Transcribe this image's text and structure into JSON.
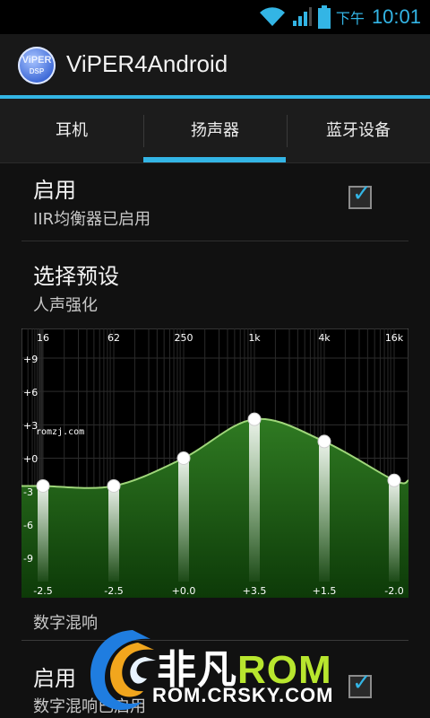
{
  "status_bar": {
    "ampm": "下午",
    "time": "10:01"
  },
  "app": {
    "icon_line1": "ViPER",
    "icon_line2": "DSP",
    "title": "ViPER4Android"
  },
  "tabs": [
    {
      "label": "耳机",
      "selected": false
    },
    {
      "label": "扬声器",
      "selected": true
    },
    {
      "label": "蓝牙设备",
      "selected": false
    }
  ],
  "prefs": {
    "enable": {
      "title": "启用",
      "summary": "IIR均衡器已启用",
      "checked": true
    },
    "preset": {
      "title": "选择预设",
      "summary": "人声强化"
    },
    "section_reverb": "数字混响",
    "enable2": {
      "title": "启用",
      "summary": "数字混响已启用",
      "checked": true
    }
  },
  "equalizer": {
    "freq_labels": [
      "16",
      "62",
      "250",
      "1k",
      "4k",
      "16k"
    ],
    "db_labels": [
      "+9",
      "+6",
      "+3",
      "+0",
      "-3",
      "-6",
      "-9"
    ],
    "bands": [
      {
        "value": -2.5,
        "label": "-2.5"
      },
      {
        "value": -2.5,
        "label": "-2.5"
      },
      {
        "value": 0.0,
        "label": "+0.0"
      },
      {
        "value": 3.5,
        "label": "+3.5"
      },
      {
        "value": 1.5,
        "label": "+1.5"
      },
      {
        "value": -2.0,
        "label": "-2.0"
      }
    ],
    "overlay_text": "romzj.com"
  },
  "watermark": {
    "brand_cn": "非凡",
    "brand_rom": "ROM",
    "url": "ROM.CRSKY.COM"
  },
  "colors": {
    "accent": "#33b5e5",
    "eq_fill": "#1a5a14",
    "watermark_green": "#b8e62e"
  }
}
